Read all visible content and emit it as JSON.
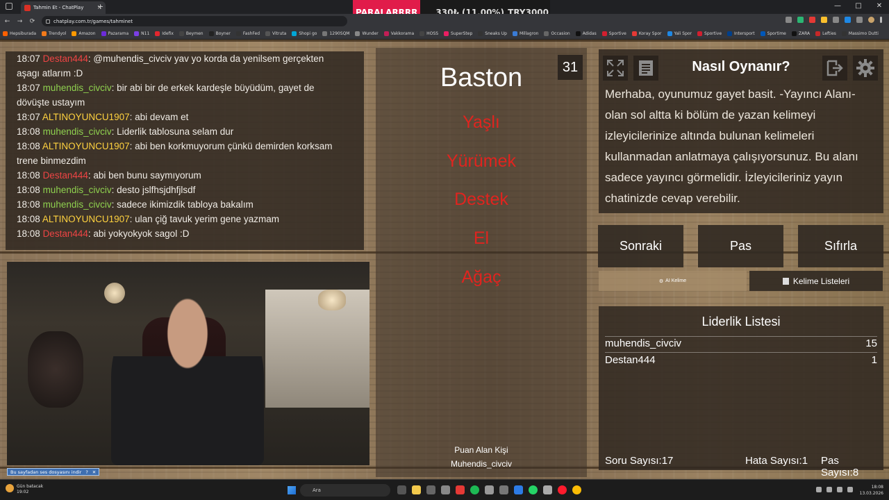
{
  "browser": {
    "tab_title": "Tahmin Et - ChatPlay",
    "tab_close": "×",
    "new_tab": "+",
    "url": "chatplay.com.tr/games/tahminet",
    "back": "←",
    "forward": "→",
    "reload": "⟳",
    "window_controls": [
      "—",
      "□",
      "✕"
    ]
  },
  "promo": {
    "brand": "PARALARRRR",
    "value": "330₺ (11.00%)",
    "target": "TRY3000"
  },
  "bookmarks": [
    {
      "label": "Hepsiburada",
      "color": "#ff6000"
    },
    {
      "label": "Trendyol",
      "color": "#f27a1a"
    },
    {
      "label": "Amazon",
      "color": "#ff9900"
    },
    {
      "label": "Pazarama",
      "color": "#6c2bd9"
    },
    {
      "label": "N11",
      "color": "#7b3fe4"
    },
    {
      "label": "Idefix",
      "color": "#e3262e"
    },
    {
      "label": "Beymen",
      "color": "#444444"
    },
    {
      "label": "Boyner",
      "color": "#222222"
    },
    {
      "label": "FashFed",
      "color": "#333333"
    },
    {
      "label": "Vitruta",
      "color": "#555555"
    },
    {
      "label": "Shopi go",
      "color": "#00a6d6"
    },
    {
      "label": "1290SQM",
      "color": "#777777"
    },
    {
      "label": "Wunder",
      "color": "#888888"
    },
    {
      "label": "Vakkorama",
      "color": "#c21e56"
    },
    {
      "label": "HOSS",
      "color": "#444444"
    },
    {
      "label": "SuperStep",
      "color": "#e91e63"
    },
    {
      "label": "Sneaks Up",
      "color": "#333333"
    },
    {
      "label": "Millagron",
      "color": "#3a7bd5"
    },
    {
      "label": "Occasion",
      "color": "#666666"
    },
    {
      "label": "Adidas",
      "color": "#111111"
    },
    {
      "label": "Sportive",
      "color": "#d21f2f"
    },
    {
      "label": "Koray Spor",
      "color": "#e53935"
    },
    {
      "label": "Yali Spor",
      "color": "#1e88e5"
    },
    {
      "label": "Sportive",
      "color": "#d21f2f"
    },
    {
      "label": "Intersport",
      "color": "#003f8a"
    },
    {
      "label": "Sportime",
      "color": "#0057b8"
    },
    {
      "label": "ZARA",
      "color": "#111111"
    },
    {
      "label": "Lefties",
      "color": "#c62828"
    },
    {
      "label": "Massimo Dutti",
      "color": "#333333"
    }
  ],
  "chat": [
    {
      "time": "18:07",
      "user": "Destan444",
      "color": "red",
      "text": ": @muhendis_civciv yav yo korda da yenilsem gerçekten"
    },
    {
      "time": "",
      "user": "",
      "color": "",
      "text": "aşagı atlarım :D"
    },
    {
      "time": "18:07",
      "user": "muhendis_civciv",
      "color": "green",
      "text": ": bir abi bir de erkek kardeşle büyüdüm, gayet de"
    },
    {
      "time": "",
      "user": "",
      "color": "",
      "text": "dövüşte ustayım"
    },
    {
      "time": "18:07",
      "user": "ALTINOYUNCU1907",
      "color": "yellow",
      "text": ": abi devam et"
    },
    {
      "time": "18:08",
      "user": "muhendis_civciv",
      "color": "green",
      "text": ": Liderlik tablosuna selam dur"
    },
    {
      "time": "18:08",
      "user": "ALTINOYUNCU1907",
      "color": "yellow",
      "text": ": abi ben korkmuyorum çünkü demirden korksam"
    },
    {
      "time": "",
      "user": "",
      "color": "",
      "text": "trene binmezdim"
    },
    {
      "time": "18:08",
      "user": "Destan444",
      "color": "red",
      "text": ": abi ben bunu saymıyorum"
    },
    {
      "time": "18:08",
      "user": "muhendis_civciv",
      "color": "green",
      "text": ": desto jslfhsjdhfjlsdf"
    },
    {
      "time": "18:08",
      "user": "muhendis_civciv",
      "color": "green",
      "text": ": sadece ikimizdik tabloya bakalım"
    },
    {
      "time": "18:08",
      "user": "ALTINOYUNCU1907",
      "color": "yellow",
      "text": ": ulan çiğ tavuk yerim gene yazmam"
    },
    {
      "time": "18:08",
      "user": "Destan444",
      "color": "red",
      "text": ": abi yokyokyok sagol :D"
    }
  ],
  "download_bar": {
    "label": "Bu sayfadan ses dosyasını indir",
    "help": "?",
    "close": "✕"
  },
  "game": {
    "counter": "31",
    "word": "Baston",
    "taboo": [
      "Yaşlı",
      "Yürümek",
      "Destek",
      "El",
      "Ağaç"
    ],
    "scorer_label": "Puan Alan Kişi",
    "scorer_name": "Muhendis_civciv"
  },
  "howto": {
    "title": "Nasıl Oynanır?",
    "text": "Merhaba, oyunumuz gayet basit. -Yayıncı Alanı- olan sol altta ki bölüm de yazan kelimeyi izleyicilerinize altında bulunan kelimeleri kullanmadan anlatmaya çalışıyorsunuz. Bu alanı sadece yayıncı görmelidir. İzleyicileriniz yayın chatinizde cevap verebilir."
  },
  "controls": {
    "next": "Sonraki",
    "pass": "Pas",
    "reset": "Sıfırla",
    "ai_word": "AI Kelime",
    "word_lists": "Kelime Listeleri"
  },
  "leaderboard": {
    "title": "Liderlik Listesi",
    "rows": [
      {
        "name": "muhendis_civciv",
        "score": "15"
      },
      {
        "name": "Destan444",
        "score": "1"
      }
    ],
    "question_count": "Soru Sayısı:17",
    "error_count": "Hata Sayısı:1",
    "pass_count": "Pas Sayısı:8"
  },
  "taskbar": {
    "weather_line1": "Gün batacak",
    "weather_line2": "19:02",
    "search": "Ara",
    "time": "18:08",
    "date": "13.03.2026"
  }
}
